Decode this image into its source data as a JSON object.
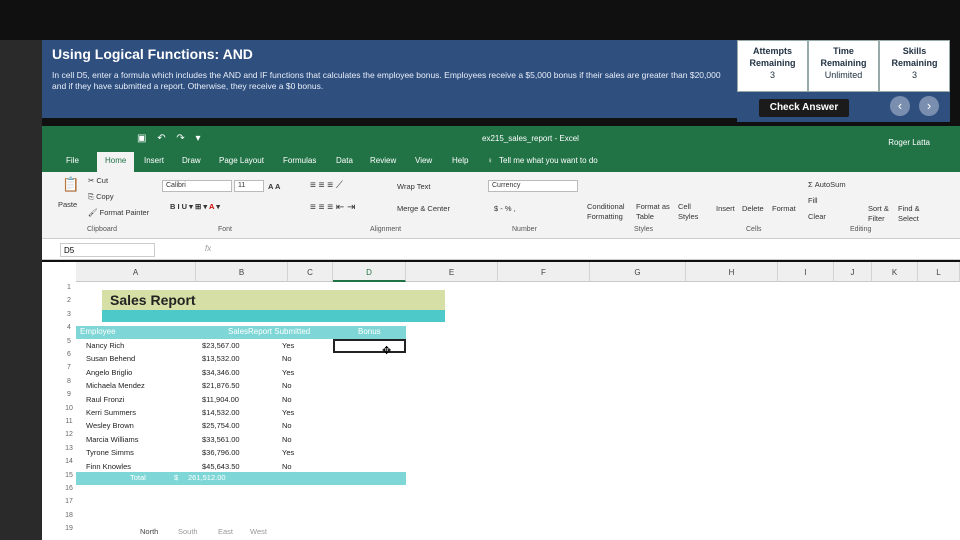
{
  "instruction": {
    "title": "Using Logical Functions: AND",
    "text": "In cell D5, enter a formula which includes the AND and IF functions that calculates the employee bonus. Employees receive a $5,000 bonus if their sales are greater than $20,000 and if they have submitted a report. Otherwise, they receive a $0 bonus."
  },
  "stats": [
    {
      "label": "Attempts Remaining",
      "value": "3"
    },
    {
      "label": "Time Remaining",
      "value": "Unlimited"
    },
    {
      "label": "Skills Remaining",
      "value": "3"
    }
  ],
  "check_answer": "Check Answer",
  "excel": {
    "filename": "ex215_sales_report  -  Excel",
    "user": "Roger Latta",
    "tabs": [
      "File",
      "Home",
      "Insert",
      "Draw",
      "Page Layout",
      "Formulas",
      "Data",
      "Review",
      "View",
      "Help"
    ],
    "tell_me": "Tell me what you want to do",
    "ribbon": {
      "cut": "Cut",
      "copy": "Copy",
      "format_painter": "Format Painter",
      "paste": "Paste",
      "clipboard": "Clipboard",
      "font_name": "Calibri",
      "font_size": "11",
      "font_group": "Font",
      "wrap_text": "Wrap Text",
      "merge_center": "Merge & Center",
      "alignment": "Alignment",
      "number_format": "Currency",
      "number_symbols": "$ - % ,",
      "number_group": "Number",
      "conditional": "Conditional Formatting",
      "format_table": "Format as Table",
      "cell_styles": "Cell Styles",
      "styles": "Styles",
      "insert": "Insert",
      "delete": "Delete",
      "format": "Format",
      "cells": "Cells",
      "autosum": "AutoSum",
      "fill": "Fill",
      "clear": "Clear",
      "sort_filter": "Sort & Filter",
      "find_select": "Find & Select",
      "editing": "Editing"
    },
    "name_box": "D5",
    "fx": "fx",
    "columns": [
      "A",
      "B",
      "C",
      "D",
      "E",
      "F",
      "G",
      "H",
      "I",
      "J",
      "K",
      "L"
    ],
    "rows": [
      "1",
      "2",
      "3",
      "4",
      "5",
      "6",
      "7",
      "8",
      "9",
      "10",
      "11",
      "12",
      "13",
      "14",
      "15",
      "16",
      "17",
      "18",
      "19"
    ],
    "report_title": "Sales Report",
    "headers": {
      "employee": "Employee",
      "sales": "Sales",
      "report": "Report Submitted",
      "bonus": "Bonus"
    },
    "employees": [
      {
        "name": "Nancy Rich",
        "sales": "$23,567.00",
        "report": "Yes"
      },
      {
        "name": "Susan Behend",
        "sales": "$13,532.00",
        "report": "No"
      },
      {
        "name": "Angelo Briglio",
        "sales": "$34,346.00",
        "report": "Yes"
      },
      {
        "name": "Michaela Mendez",
        "sales": "$21,876.50",
        "report": "No"
      },
      {
        "name": "Raul Fronzi",
        "sales": "$11,904.00",
        "report": "No"
      },
      {
        "name": "Kerri Summers",
        "sales": "$14,532.00",
        "report": "Yes"
      },
      {
        "name": "Wesley Brown",
        "sales": "$25,754.00",
        "report": "No"
      },
      {
        "name": "Marcia Williams",
        "sales": "$33,561.00",
        "report": "No"
      },
      {
        "name": "Tyrone Simms",
        "sales": "$36,796.00",
        "report": "Yes"
      },
      {
        "name": "Finn Knowles",
        "sales": "$45,643.50",
        "report": "No"
      }
    ],
    "total_label": "Total",
    "total_symbol": "$",
    "total_value": "261,512.00",
    "sheet_tabs": [
      "North",
      "South",
      "East",
      "West"
    ]
  }
}
